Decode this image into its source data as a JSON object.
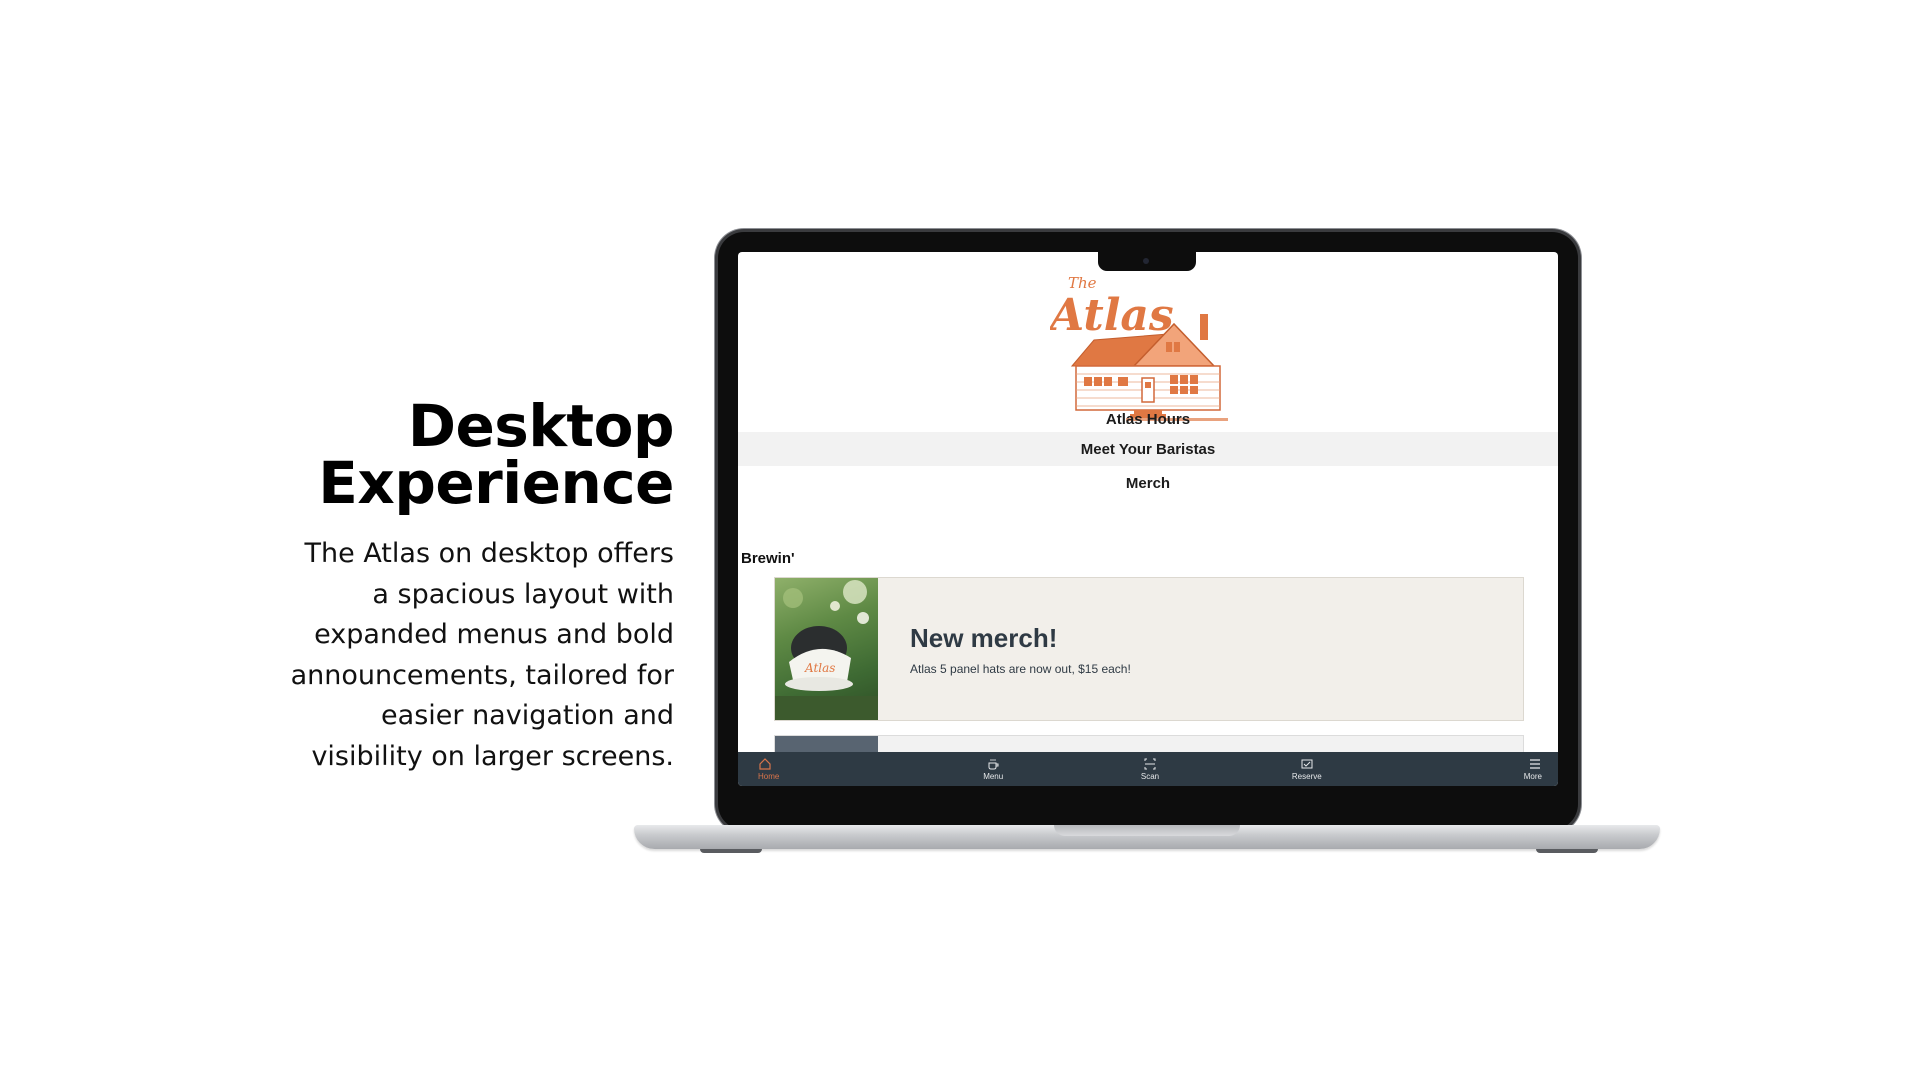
{
  "intro": {
    "title_line1": "Desktop",
    "title_line2": "Experience",
    "body_lines": [
      "The Atlas on desktop offers",
      "a spacious layout with",
      "expanded menus and bold",
      "announcements, tailored for",
      "easier navigation and",
      "visibility on larger screens."
    ]
  },
  "site": {
    "logo": {
      "script_small": "The",
      "script_large": "Atlas",
      "icon": "house-logo-icon"
    },
    "nav_links": [
      "Atlas Hours",
      "Meet Your Baristas",
      "Merch"
    ],
    "section_label": "Brewin'",
    "announcement": {
      "title": "New merch!",
      "text": "Atlas 5 panel hats are now out, $15 each!",
      "image": "hat-photo"
    },
    "tabbar": {
      "items": [
        {
          "label": "Home",
          "icon": "home-icon",
          "active": true
        },
        {
          "label": "Menu",
          "icon": "coffee-cup-icon",
          "active": false
        },
        {
          "label": "Scan",
          "icon": "scan-icon",
          "active": false
        },
        {
          "label": "Reserve",
          "icon": "reserve-icon",
          "active": false
        },
        {
          "label": "More",
          "icon": "hamburger-menu-icon",
          "active": false
        }
      ]
    }
  },
  "colors": {
    "brand_orange": "#E07843",
    "tabbar_bg": "#2E3A44",
    "announcement_bg": "#F2EFEA",
    "active_tab": "#D8744A"
  }
}
